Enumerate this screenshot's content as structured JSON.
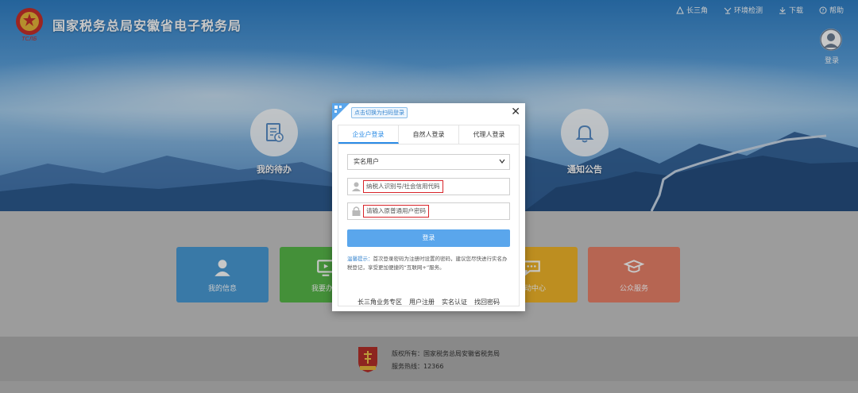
{
  "header": {
    "site_title": "国家税务总局安徽省电子税务局",
    "nav": [
      {
        "label": "长三角",
        "icon": "triangle-icon"
      },
      {
        "label": "环境检测",
        "icon": "monitor-icon"
      },
      {
        "label": "下载",
        "icon": "download-icon"
      },
      {
        "label": "帮助",
        "icon": "help-icon"
      }
    ],
    "login_label": "登录"
  },
  "hero": {
    "todo_label": "我的待办",
    "notice_label": "通知公告"
  },
  "tiles": [
    {
      "label": "我的信息",
      "color": "#4a9bd6"
    },
    {
      "label": "我要办税",
      "color": "#58b94a"
    },
    {
      "label": "互动中心",
      "color": "#f2b62a"
    },
    {
      "label": "公众服务",
      "color": "#e9826a"
    }
  ],
  "modal": {
    "qr_tip": "点击切换为扫码登录",
    "close": "✕",
    "tabs": [
      "企业户登录",
      "自然人登录",
      "代理人登录"
    ],
    "active_tab": 0,
    "user_type_selected": "实名用户",
    "taxpayer_id_placeholder": "纳税人识别号/社会信用代码",
    "password_placeholder": "请输入原普通用户密码",
    "login_button": "登录",
    "tip_prefix": "温馨提示：",
    "tip_body": "首次登录密码为注册时设置的密码，建议您尽快进行实名办税登记，享受更加便捷的“互联网+”服务。",
    "links": [
      "长三角业务专区",
      "用户注册",
      "实名认证",
      "找回密码"
    ]
  },
  "footer": {
    "copyright": "版权所有：国家税务总局安徽省税务局",
    "hotline": "服务热线：12366"
  },
  "colors": {
    "accent": "#2a8be6",
    "login_button": "#5aa6ec",
    "highlight_box": "#d8242a"
  }
}
